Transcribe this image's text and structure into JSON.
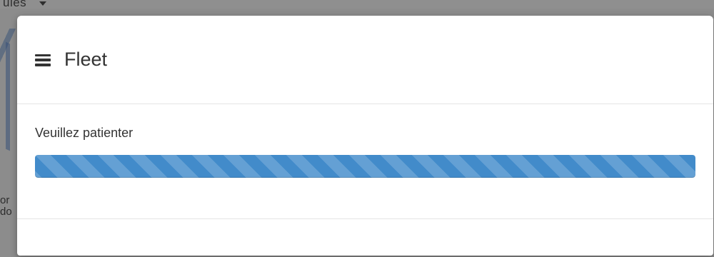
{
  "background": {
    "top_text": "ules",
    "side_text": "or\ndo",
    "bottom_text": "..."
  },
  "modal": {
    "title": "Fleet",
    "message": "Veuillez patienter",
    "progress_percent": 100,
    "progress_color": "#428bca"
  }
}
